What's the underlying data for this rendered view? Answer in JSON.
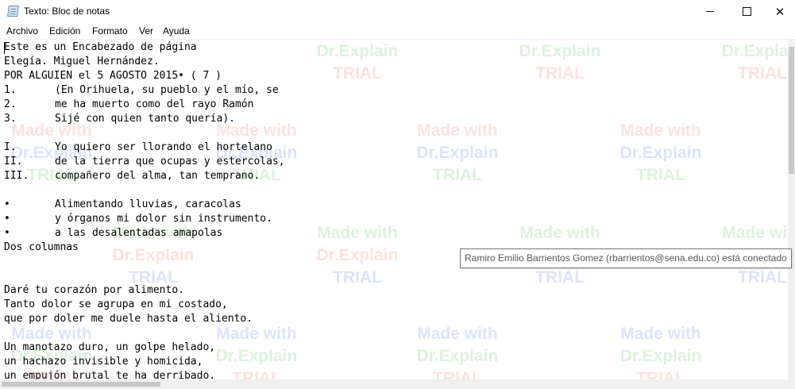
{
  "window": {
    "title": "Texto: Bloc de notas",
    "icon": "notepad-icon",
    "controls": {
      "minimize": "minimize-icon",
      "maximize": "maximize-icon",
      "close_glyph": "✕"
    }
  },
  "menu": [
    "Archivo",
    "Edición",
    "Formato",
    "Ver",
    "Ayuda"
  ],
  "document": {
    "header": "Este es un Encabezado de página",
    "title_line": "Elegía. Miguel Hernández.",
    "subtitle_line": "POR ALGUIEN el 5 AGOSTO 2015• ( 7 )",
    "numbered": [
      {
        "marker": "1.",
        "text": "(En Orihuela, su pueblo y el mío, se"
      },
      {
        "marker": "2.",
        "text": "me ha muerto como del rayo Ramón"
      },
      {
        "marker": "3.",
        "text": "Sijé con quien tanto quería)."
      }
    ],
    "roman": [
      {
        "marker": "I.",
        "text": "Yo quiero ser llorando el hortelano"
      },
      {
        "marker": "II.",
        "text": "de la tierra que ocupas y estercolas,"
      },
      {
        "marker": "III.",
        "text": "compañero del alma, tan temprano."
      }
    ],
    "bullets": [
      {
        "marker": "•",
        "text": "Alimentando lluvias, caracolas"
      },
      {
        "marker": "•",
        "text": "y órganos mi dolor sin instrumento."
      },
      {
        "marker": "•",
        "text": "a las desalentadas amapolas"
      }
    ],
    "section_label": "Dos columnas",
    "stanza1": [
      "Daré tu corazón por alimento.",
      "Tanto dolor se agrupa en mi costado,",
      "que por doler me duele hasta el aliento."
    ],
    "stanza2": [
      "Un manotazo duro, un golpe helado,",
      "un hachazo invisible y homicida,",
      "un empujón brutal te ha derribado."
    ]
  },
  "watermark": [
    "Made with",
    "Dr.Explain",
    "TRIAL"
  ],
  "tooltip": "Ramiro Emilio Barrientos Gomez (rbarrientos@sena.edu.co) está conectado",
  "colors": {
    "watermark_blue": "#0026ff",
    "watermark_green": "#00a000",
    "watermark_red": "#ff1a1a",
    "tooltip_border": "#767676"
  }
}
